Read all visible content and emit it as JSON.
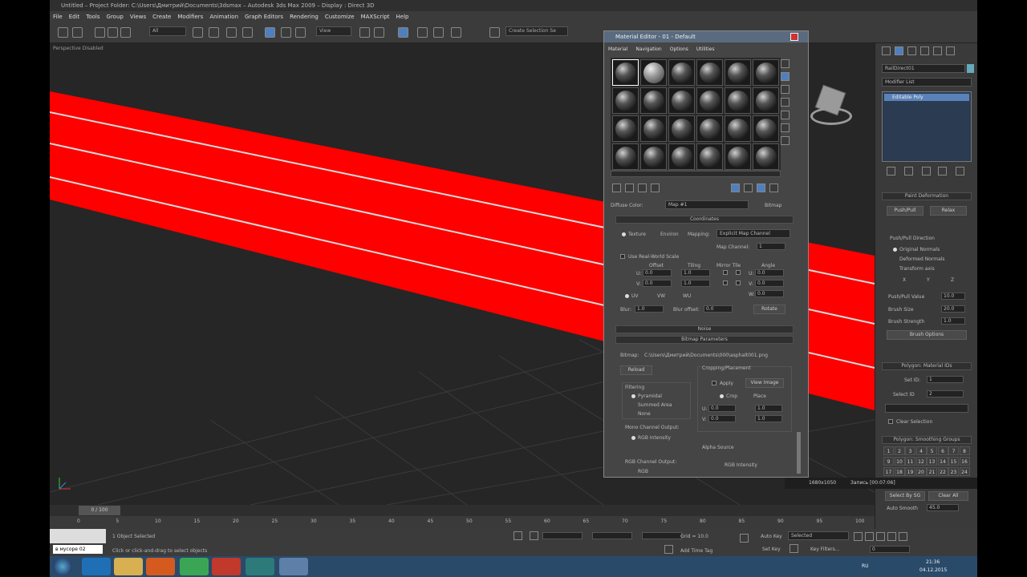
{
  "window": {
    "title": "Untitled     –  Project Folder: C:\\Users\\Дмитрий\\Documents\\3dsmax     –  Autodesk 3ds Max  2009     –  Display : Direct 3D"
  },
  "menubar": [
    "File",
    "Edit",
    "Tools",
    "Group",
    "Views",
    "Create",
    "Modifiers",
    "Animation",
    "Graph Editors",
    "Rendering",
    "Customize",
    "MAXScript",
    "Help"
  ],
  "toolbar": {
    "selection_filter": "All",
    "ref_coord": "View",
    "named_sets": "Create Selection Se"
  },
  "viewport": {
    "label": "Perspective Disabled"
  },
  "material_editor": {
    "title": "Material Editor - 01 - Default",
    "menu": [
      "Material",
      "Navigation",
      "Options",
      "Utilities"
    ],
    "diffuse_label": "Diffuse Color:",
    "map_name": "Map #1",
    "map_type": "Bitmap",
    "coordinates": {
      "header": "Coordinates",
      "texture": "Texture",
      "environ": "Environ",
      "mapping_label": "Mapping:",
      "mapping_value": "Explicit Map Channel",
      "map_channel_label": "Map Channel:",
      "map_channel_value": "1",
      "real_world": "Use Real-World Scale",
      "offset": "Offset",
      "tiling": "Tiling",
      "mirror_tile": "Mirror Tile",
      "angle": "Angle",
      "u_label": "U:",
      "v_label": "V:",
      "w_label": "W:",
      "u_offset": "0.0",
      "v_offset": "0.0",
      "u_tiling": "1.0",
      "v_tiling": "1.0",
      "u_angle": "0.0",
      "v_angle": "0.0",
      "w_angle": "0.0",
      "uv": "UV",
      "vw": "VW",
      "wu": "WU",
      "blur_label": "Blur:",
      "blur_value": "1.0",
      "blur_offset_label": "Blur offset:",
      "blur_offset_value": "0.0",
      "rotate": "Rotate"
    },
    "noise_header": "Noise",
    "bitmap_params": {
      "header": "Bitmap Parameters",
      "bitmap_label": "Bitmap:",
      "bitmap_path": "C:\\Users\\Дмитрий\\Documents\\000\\asphalt001.png",
      "reload": "Reload",
      "cropping": "Cropping/Placement",
      "apply": "Apply",
      "view_image": "View Image",
      "crop": "Crop",
      "place": "Place",
      "u_val": "0.0",
      "v_val": "0.0",
      "w_val": "1.0",
      "h_val": "1.0",
      "filtering": "Filtering",
      "pyramidal": "Pyramidal",
      "summed_area": "Summed Area",
      "none": "None",
      "mono_output": "Mono Channel Output:",
      "rgb_intensity": "RGB Intensity",
      "alpha_source": "Alpha Source",
      "alpha_rgb_intensity": "RGB Intensity",
      "rgb_output": "RGB Channel Output:",
      "rgb": "RGB"
    }
  },
  "command_panel": {
    "object_name": "RailDirect01",
    "modifier_list": "Modifier List",
    "stack_item": "Editable Poly",
    "paint_deformation": "Paint Deformation",
    "push_pull": "Push/Pull",
    "relax": "Relax",
    "direction": "Push/Pull Direction",
    "original_normals": "Original Normals",
    "deformed_normals": "Deformed Normals",
    "transform_axis": "Transform axis",
    "x": "X",
    "y": "Y",
    "z": "Z",
    "push_value_label": "Push/Pull Value",
    "push_value": "10.0",
    "brush_size_label": "Brush Size",
    "brush_size": "20.0",
    "brush_strength_label": "Brush Strength",
    "brush_strength": "1.0",
    "brush_options": "Brush Options",
    "material_ids": "Polygon: Material IDs",
    "set_id_label": "Set ID:",
    "set_id": "1",
    "select_id_label": "Select ID",
    "select_id": "2",
    "clear_selection": "Clear Selection",
    "smoothing_groups": "Polygon: Smoothing Groups",
    "groups": [
      "1",
      "2",
      "3",
      "4",
      "5",
      "6",
      "7",
      "8",
      "9",
      "10",
      "11",
      "12",
      "13",
      "14",
      "15",
      "16",
      "17",
      "18",
      "19",
      "20",
      "21",
      "22",
      "23",
      "24"
    ],
    "select_by_sg": "Select By SG",
    "clear_all": "Clear All",
    "auto_smooth_label": "Auto Smooth",
    "auto_smooth": "45.0"
  },
  "timeline": {
    "frame": "0 / 100",
    "ticks": [
      "0",
      "5",
      "10",
      "15",
      "20",
      "25",
      "30",
      "35",
      "40",
      "45",
      "50",
      "55",
      "60",
      "65",
      "70",
      "75",
      "80",
      "85",
      "90",
      "95",
      "100"
    ]
  },
  "status": {
    "script_text": "в мусоре 02",
    "selected": "1 Object Selected",
    "prompt": "Click or click-and-drag to select objects",
    "grid": "Grid = 10.0",
    "auto_key": "Auto Key",
    "selected_dropdown": "Selected",
    "set_key": "Set Key",
    "key_filters": "Key Filters...",
    "add_time_tag": "Add Time Tag",
    "frame_field": "0",
    "resolution": "1680x1050",
    "recording": "Запись [00:07:06]"
  },
  "taskbar": {
    "lang": "RU",
    "time": "21:36",
    "date": "04.12.2015"
  }
}
